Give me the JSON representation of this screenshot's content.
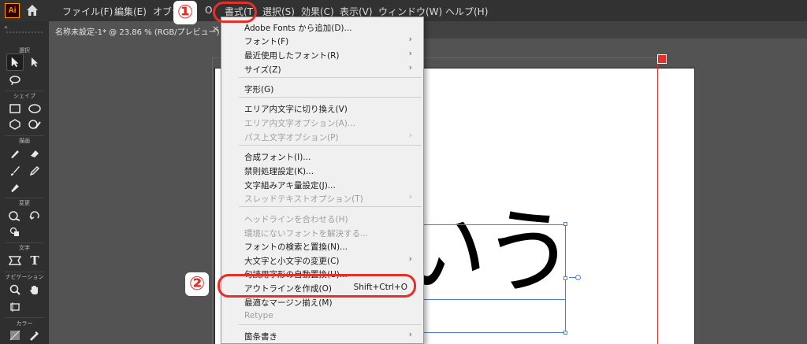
{
  "app": {
    "logo_text": "Ai",
    "accent_color": "#ff9a00"
  },
  "menubar": {
    "items": [
      {
        "label": "ファイル(F)"
      },
      {
        "label": "編集(E)"
      },
      {
        "label": "オブジ"
      },
      {
        "label": "O"
      },
      {
        "label": "書式(T)"
      },
      {
        "label": "選択(S)"
      },
      {
        "label": "効果(C)"
      },
      {
        "label": "表示(V)"
      },
      {
        "label": "ウィンドウ(W)"
      },
      {
        "label": "ヘルプ(H)"
      }
    ]
  },
  "document_tab": {
    "title": "名称未設定-1* @ 23.86 % (RGB/プレビュー)",
    "close": "×"
  },
  "toolbar": {
    "sections": {
      "select": "選択",
      "shape": "シェイプ",
      "draw": "描画",
      "transform": "変更",
      "type": "文字",
      "navigation": "ナビゲーション",
      "color": "カラー"
    },
    "type_tool_glyph": "T"
  },
  "artboard": {
    "text": "いう"
  },
  "type_menu": {
    "items": [
      {
        "label": "Adobe Fonts から追加(D)...",
        "enabled": true,
        "submenu": false
      },
      {
        "label": "フォント(F)",
        "enabled": true,
        "submenu": true
      },
      {
        "label": "最近使用したフォント(R)",
        "enabled": true,
        "submenu": true
      },
      {
        "label": "サイズ(Z)",
        "enabled": true,
        "submenu": true
      },
      {
        "label": "字形(G)",
        "enabled": true,
        "submenu": false
      },
      {
        "label": "エリア内文字に切り換え(V)",
        "enabled": true,
        "submenu": false
      },
      {
        "label": "エリア内文字オプション(A)...",
        "enabled": false,
        "submenu": false
      },
      {
        "label": "パス上文字オプション(P)",
        "enabled": false,
        "submenu": true
      },
      {
        "label": "合成フォント(I)...",
        "enabled": true,
        "submenu": false
      },
      {
        "label": "禁則処理設定(K)...",
        "enabled": true,
        "submenu": false
      },
      {
        "label": "文字組みアキ量設定(J)...",
        "enabled": true,
        "submenu": false
      },
      {
        "label": "スレッドテキストオプション(T)",
        "enabled": false,
        "submenu": true
      },
      {
        "label": "ヘッドラインを合わせる(H)",
        "enabled": false,
        "submenu": false
      },
      {
        "label": "環境にないフォントを解決する...",
        "enabled": false,
        "submenu": false
      },
      {
        "label": "フォントの検索と置換(N)...",
        "enabled": true,
        "submenu": false
      },
      {
        "label": "大文字と小文字の変更(C)",
        "enabled": true,
        "submenu": true
      },
      {
        "label": "句読用字形の自動置換(U)...",
        "enabled": true,
        "submenu": false
      },
      {
        "label": "アウトラインを作成(O)",
        "enabled": true,
        "submenu": false,
        "shortcut": "Shift+Ctrl+O"
      },
      {
        "label": "最適なマージン揃え(M)",
        "enabled": true,
        "submenu": false
      },
      {
        "label": "Retype",
        "enabled": false,
        "submenu": false
      },
      {
        "label": "箇条書き",
        "enabled": true,
        "submenu": true
      }
    ],
    "arrow_glyph": "›"
  },
  "annotations": {
    "step1": "①",
    "step2": "②",
    "highlight_color": "#e5302a"
  }
}
